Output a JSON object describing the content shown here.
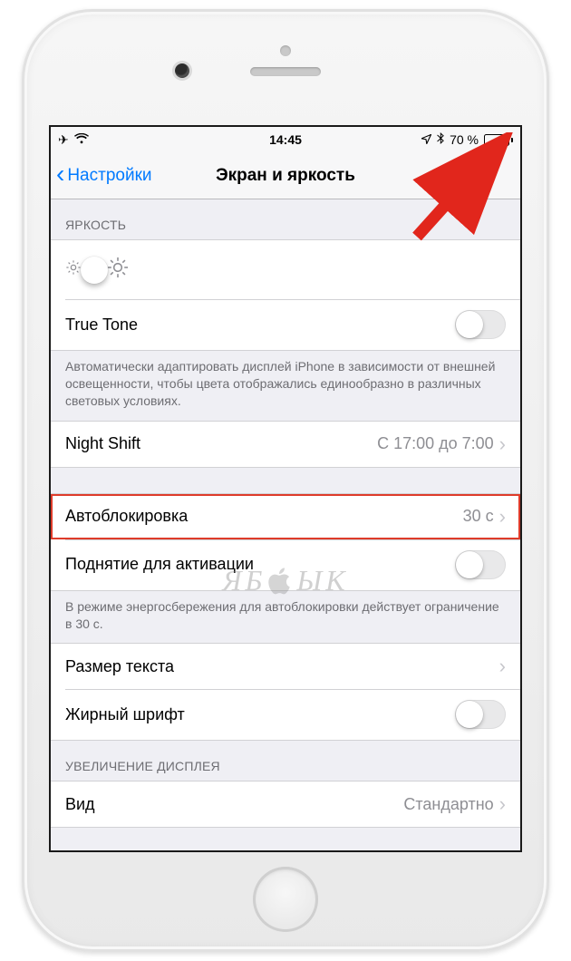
{
  "status": {
    "time": "14:45",
    "battery_pct": "70 %",
    "battery_color": "#fdbf00"
  },
  "nav": {
    "back_label": "Настройки",
    "title": "Экран и яркость"
  },
  "sections": {
    "brightness_header": "ЯРКОСТЬ",
    "true_tone_label": "True Tone",
    "true_tone_footer": "Автоматически адаптировать дисплей iPhone в зависимости от внешней освещенности, чтобы цвета отображались единообразно в различных световых условиях.",
    "night_shift_label": "Night Shift",
    "night_shift_value": "С 17:00 до 7:00",
    "autolock_label": "Автоблокировка",
    "autolock_value": "30 с",
    "raise_to_wake_label": "Поднятие для активации",
    "autolock_footer": "В режиме энергосбережения для автоблокировки действует ограничение в 30 с.",
    "text_size_label": "Размер текста",
    "bold_text_label": "Жирный шрифт",
    "zoom_header": "УВЕЛИЧЕНИЕ ДИСПЛЕЯ",
    "view_label": "Вид",
    "view_value": "Стандартно"
  },
  "watermark": {
    "left": "ЯБ",
    "right": "ЫК"
  }
}
